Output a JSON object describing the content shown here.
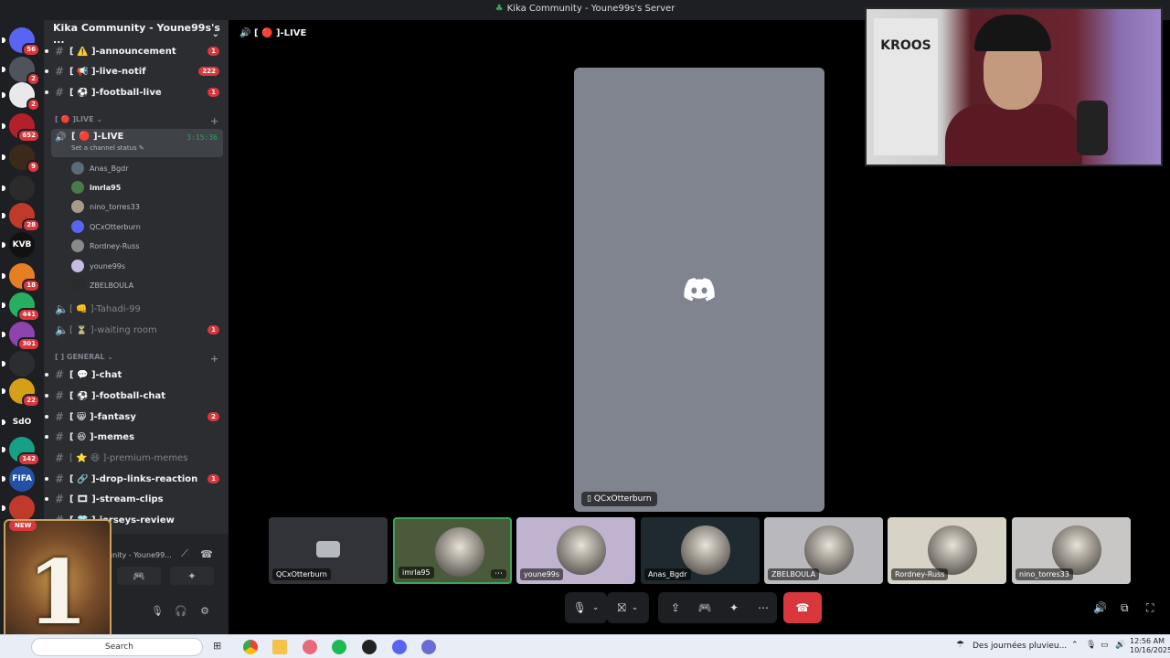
{
  "window": {
    "title": "Kika Community - Youne99s's Server"
  },
  "guild": {
    "name": "Kika Community - Youne99s's ..."
  },
  "rail": {
    "servers": [
      {
        "label": "",
        "badge": "56",
        "color": "#5865f2"
      },
      {
        "label": "",
        "badge": "2",
        "color": "#4f545c"
      },
      {
        "label": "",
        "badge": "2",
        "color": "#e9e9e9"
      },
      {
        "label": "",
        "badge": "652",
        "color": "#b3202c"
      },
      {
        "label": "",
        "badge": "9",
        "color": "#3b2a1a"
      },
      {
        "label": "",
        "badge": "",
        "color": "#2b2b2b"
      },
      {
        "label": "",
        "badge": "28",
        "color": "#c0392b"
      },
      {
        "label": "KVB",
        "badge": "",
        "color": "#111"
      },
      {
        "label": "",
        "badge": "18",
        "color": "#e67e22"
      },
      {
        "label": "",
        "badge": "441",
        "color": "#27ae60"
      },
      {
        "label": "",
        "badge": "301",
        "color": "#8e44ad"
      },
      {
        "label": "",
        "badge": "",
        "color": "#2b2d31"
      },
      {
        "label": "",
        "badge": "22",
        "color": "#d4a017"
      },
      {
        "label": "SdO",
        "badge": "",
        "color": "#1e1f22"
      },
      {
        "label": "",
        "badge": "142",
        "color": "#16a085"
      },
      {
        "label": "FIFA",
        "badge": "",
        "color": "#2451a6"
      },
      {
        "label": "",
        "badge": "",
        "color": "#c0392b"
      }
    ]
  },
  "channels": {
    "top": [
      {
        "name": "[ ⚠️ ]-announcement",
        "count": "1"
      },
      {
        "name": "[ 📢 ]-live-notif",
        "count": "222"
      },
      {
        "name": "[ ⚽ ]-football-live",
        "count": "1"
      }
    ],
    "live_category": "[ 🔴 ]LIVE",
    "live_channel": {
      "name": "[ 🔴 ]-LIVE",
      "status": "Set a channel status",
      "timer": "3:15:36"
    },
    "voice_users": [
      "Anas_Bgdr",
      "imrla95",
      "nino_torres33",
      "QCxOtterburn",
      "Rordney-Russ",
      "youne99s",
      "ZBELBOULA"
    ],
    "voice2": {
      "name": "[ 👊 ]-Tahadi-99"
    },
    "voice3": {
      "name": "[ ⏳ ]-waiting room",
      "count": "1"
    },
    "general_category": "[ ] GENERAL",
    "general": [
      {
        "name": "[ 💬 ]-chat",
        "count": ""
      },
      {
        "name": "[ ⚽ ]-football-chat",
        "count": ""
      },
      {
        "name": "[ 😸 ]-fantasy",
        "count": "2"
      },
      {
        "name": "[ 😆 ]-memes",
        "count": ""
      },
      {
        "name": "[ ⭐ 😆 ]-premium-memes",
        "count": ""
      },
      {
        "name": "[ 🔗 ]-drop-links-reaction",
        "count": "1"
      },
      {
        "name": "[ 🎞 ]-stream-clips",
        "count": ""
      },
      {
        "name": "[ 👕 ]-jerseys-review",
        "count": ""
      }
    ]
  },
  "userpanel": {
    "server_line": "unity - Youne99..."
  },
  "promo": {
    "number": "1",
    "badge": "NEW"
  },
  "main": {
    "header": "[ 🔴 ]-LIVE",
    "stage_user": "QCxOtterburn",
    "tiles": [
      {
        "name": "QCxOtterburn",
        "color": "#313338"
      },
      {
        "name": "imrla95",
        "color": "#4a5a3a"
      },
      {
        "name": "youne99s",
        "color": "#bfb3cf"
      },
      {
        "name": "Anas_Bgdr",
        "color": "#1f2a30"
      },
      {
        "name": "ZBELBOULA",
        "color": "#b9b9bd"
      },
      {
        "name": "Rordney-Russ",
        "color": "#d8d3c7"
      },
      {
        "name": "nino_torres33",
        "color": "#c9c7c5"
      }
    ]
  },
  "taskbar": {
    "search_placeholder": "Search",
    "weather": "Des journées pluvieu...",
    "time": "12:56 AM",
    "date": "10/16/2025"
  },
  "webcam": {
    "jersey_text": "KROOS"
  }
}
